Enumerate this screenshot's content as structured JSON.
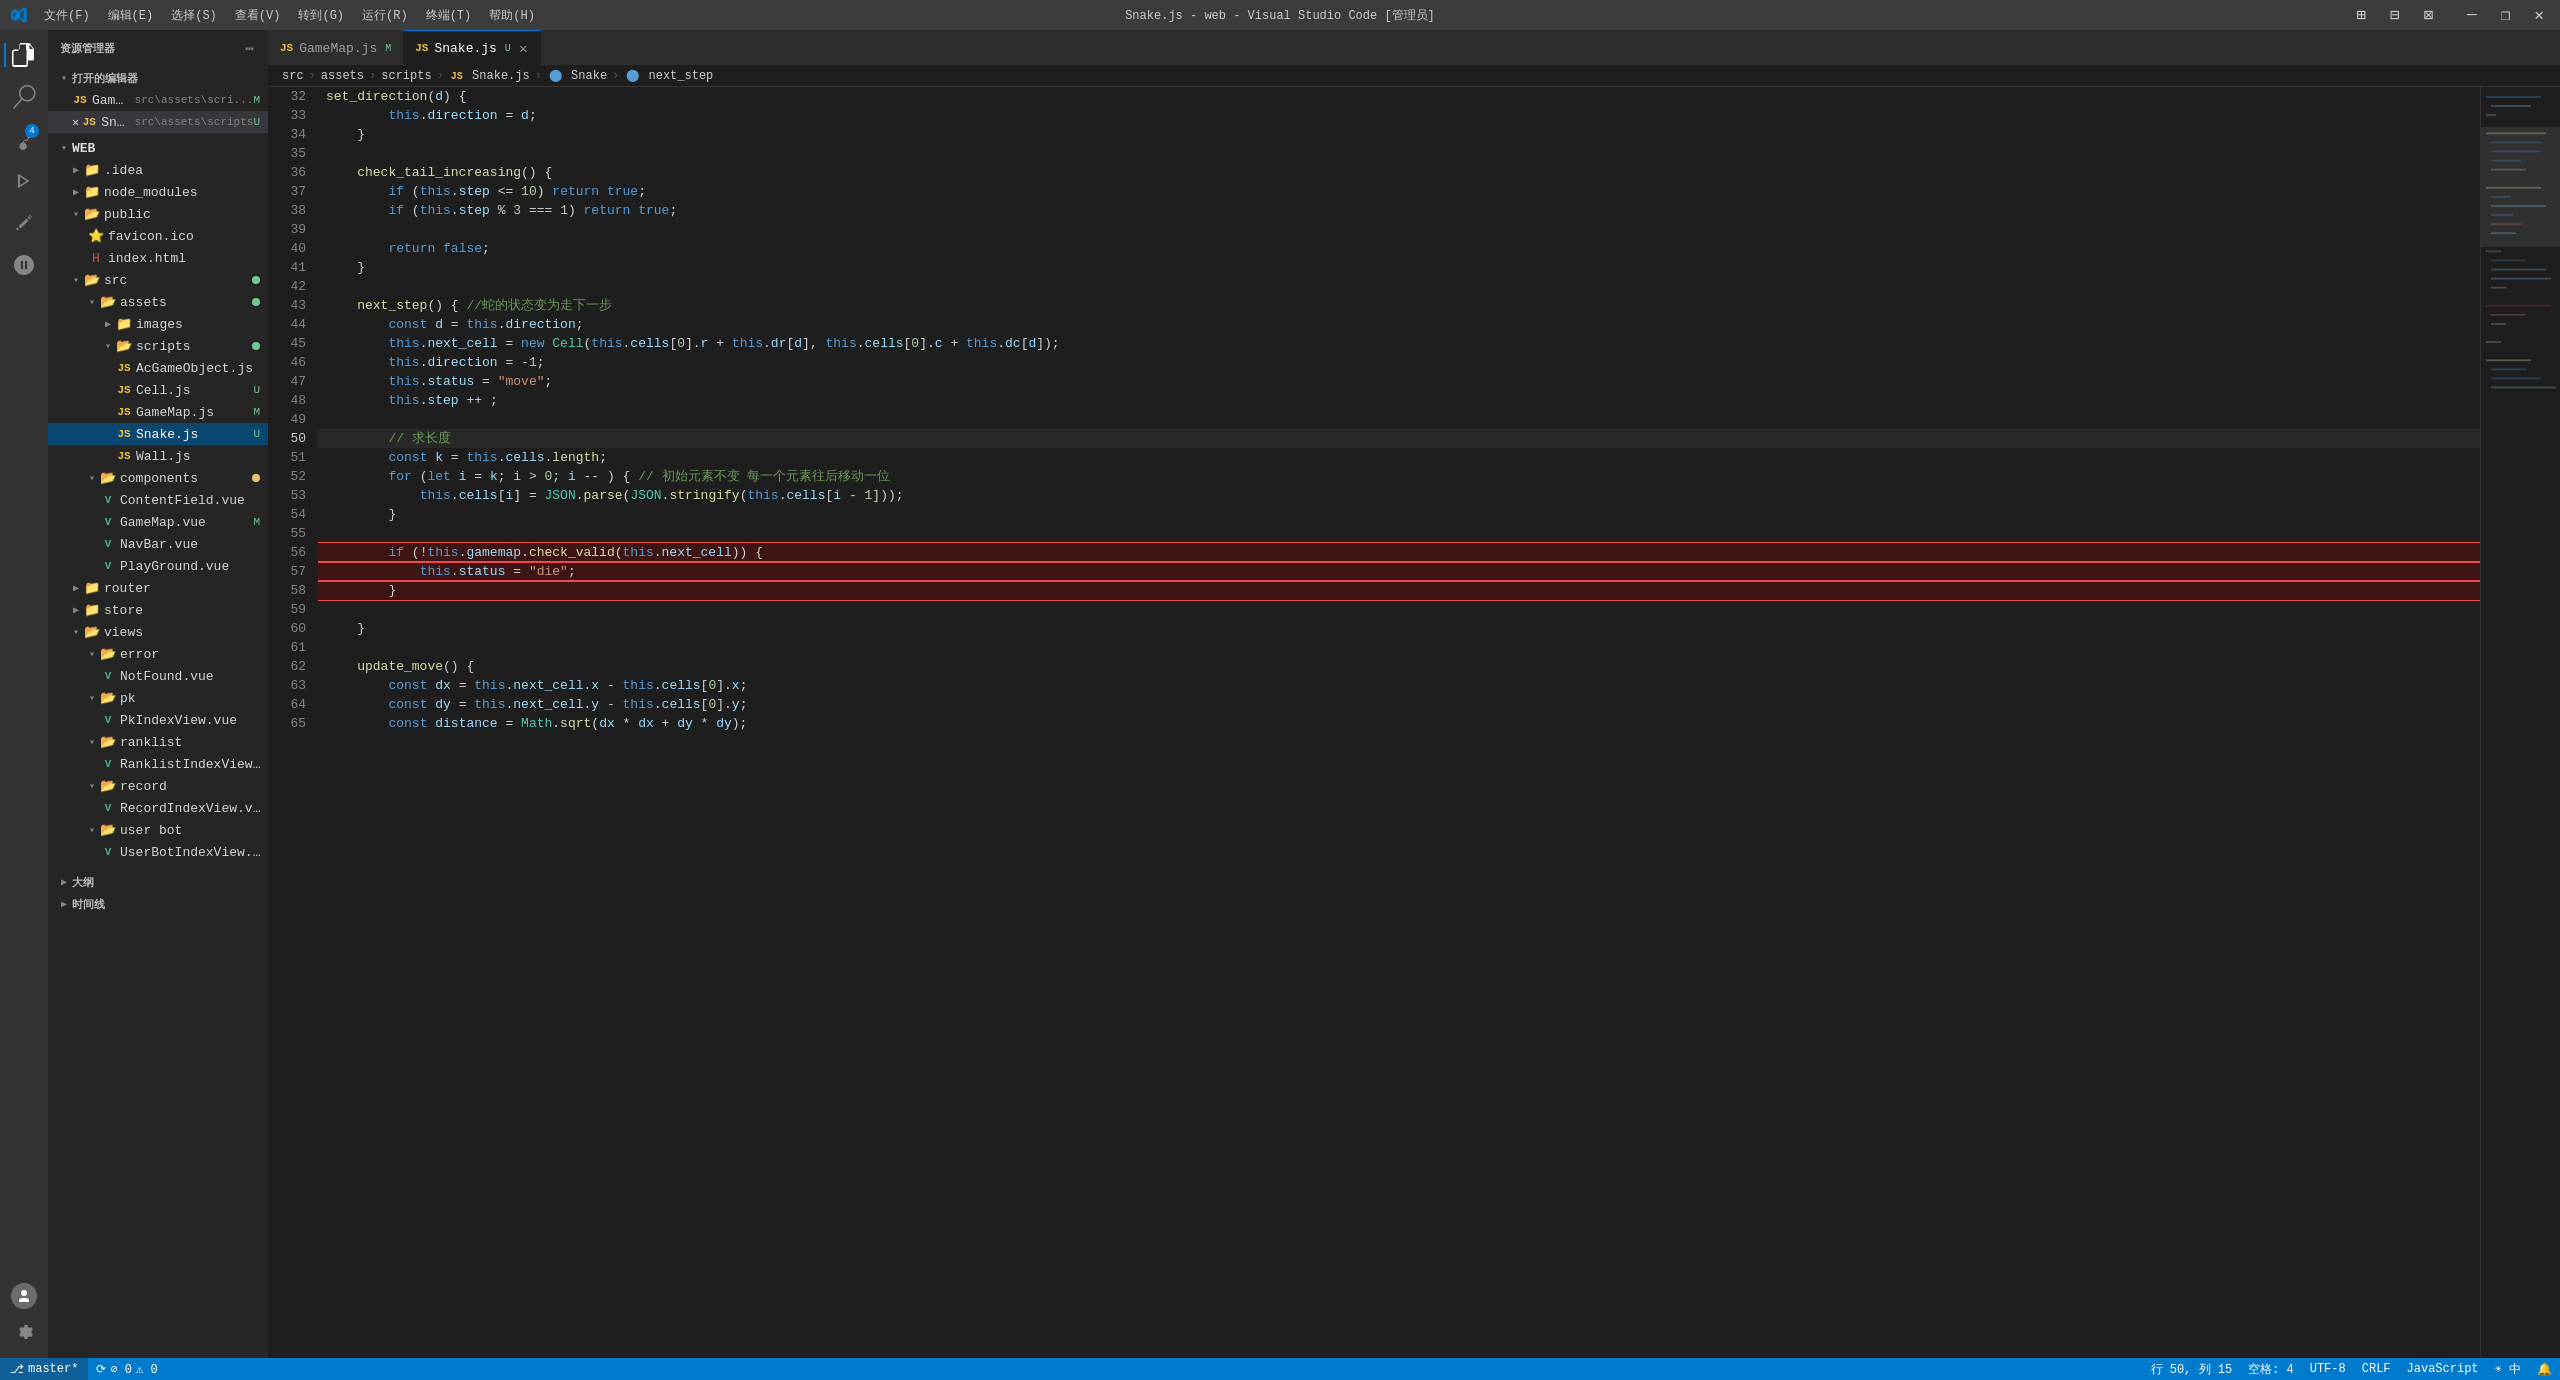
{
  "titlebar": {
    "title": "Snake.js - web - Visual Studio Code [管理员]",
    "menus": [
      "文件(F)",
      "编辑(E)",
      "选择(S)",
      "查看(V)",
      "转到(G)",
      "运行(R)",
      "终端(T)",
      "帮助(H)"
    ],
    "controls": [
      "—",
      "❐",
      "✕"
    ]
  },
  "sidebar": {
    "header": "资源管理器",
    "open_editors_label": "打开的编辑器",
    "open_editors": [
      {
        "name": "GameMap.js",
        "path": "src\\assets\\scri...",
        "badge": "M",
        "icon": "JS"
      },
      {
        "name": "Snake.js",
        "path": "src\\assets\\scripts",
        "badge": "U",
        "icon": "JS",
        "active": true
      }
    ],
    "project_name": "WEB",
    "tree": [
      {
        "name": ".idea",
        "type": "folder",
        "indent": 1,
        "collapsed": true
      },
      {
        "name": "node_modules",
        "type": "folder",
        "indent": 1,
        "collapsed": true
      },
      {
        "name": "public",
        "type": "folder",
        "indent": 1,
        "expanded": true
      },
      {
        "name": "favicon.ico",
        "type": "file",
        "indent": 2,
        "icon": "⭐"
      },
      {
        "name": "index.html",
        "type": "file",
        "indent": 2,
        "icon": "H"
      },
      {
        "name": "src",
        "type": "folder",
        "indent": 1,
        "expanded": true,
        "dot": "green"
      },
      {
        "name": "assets",
        "type": "folder",
        "indent": 2,
        "expanded": true,
        "dot": "green"
      },
      {
        "name": "images",
        "type": "folder",
        "indent": 3,
        "collapsed": true
      },
      {
        "name": "scripts",
        "type": "folder",
        "indent": 3,
        "expanded": true,
        "dot": "green"
      },
      {
        "name": "AcGameObject.js",
        "type": "file",
        "indent": 4,
        "icon": "JS"
      },
      {
        "name": "Cell.js",
        "type": "file",
        "indent": 4,
        "icon": "JS",
        "badge": "U"
      },
      {
        "name": "GameMap.js",
        "type": "file",
        "indent": 4,
        "icon": "JS",
        "badge": "M"
      },
      {
        "name": "Snake.js",
        "type": "file",
        "indent": 4,
        "icon": "JS",
        "badge": "U",
        "active": true
      },
      {
        "name": "Wall.js",
        "type": "file",
        "indent": 4,
        "icon": "JS"
      },
      {
        "name": "components",
        "type": "folder",
        "indent": 2,
        "expanded": true,
        "dot": "yellow"
      },
      {
        "name": "ContentField.vue",
        "type": "file",
        "indent": 3,
        "icon": "V"
      },
      {
        "name": "GameMap.vue",
        "type": "file",
        "indent": 3,
        "icon": "V",
        "badge": "M"
      },
      {
        "name": "NavBar.vue",
        "type": "file",
        "indent": 3,
        "icon": "V"
      },
      {
        "name": "PlayGround.vue",
        "type": "file",
        "indent": 3,
        "icon": "V"
      },
      {
        "name": "router",
        "type": "folder",
        "indent": 1,
        "collapsed": true
      },
      {
        "name": "store",
        "type": "folder",
        "indent": 1,
        "collapsed": true
      },
      {
        "name": "views",
        "type": "folder",
        "indent": 1,
        "expanded": true
      },
      {
        "name": "error",
        "type": "folder",
        "indent": 2,
        "expanded": true
      },
      {
        "name": "NotFound.vue",
        "type": "file",
        "indent": 3,
        "icon": "V"
      },
      {
        "name": "pk",
        "type": "folder",
        "indent": 2,
        "expanded": true
      },
      {
        "name": "PkIndexView.vue",
        "type": "file",
        "indent": 3,
        "icon": "V"
      },
      {
        "name": "ranklist",
        "type": "folder",
        "indent": 2,
        "expanded": true
      },
      {
        "name": "RanklistIndexView.vue",
        "type": "file",
        "indent": 3,
        "icon": "V"
      },
      {
        "name": "record",
        "type": "folder",
        "indent": 2,
        "expanded": true
      },
      {
        "name": "RecordIndexView.vue",
        "type": "file",
        "indent": 3,
        "icon": "V"
      },
      {
        "name": "user bot",
        "type": "folder",
        "indent": 2,
        "expanded": true
      },
      {
        "name": "UserBotIndexView.vue",
        "type": "file",
        "indent": 3,
        "icon": "V"
      }
    ]
  },
  "tabs": [
    {
      "name": "GameMap.js",
      "icon": "JS",
      "badge": "M",
      "active": false,
      "modified": true
    },
    {
      "name": "Snake.js",
      "icon": "JS",
      "badge": "U",
      "active": true,
      "modified": false,
      "dirty": true
    }
  ],
  "breadcrumb": [
    "src",
    ">",
    "assets",
    ">",
    "scripts",
    ">",
    "JS Snake.js",
    ">",
    "🔵 Snake",
    ">",
    "🔵 next_step"
  ],
  "code": {
    "lines": [
      {
        "num": 32,
        "content": "    set_direction(d) {"
      },
      {
        "num": 33,
        "content": "        this.direction = d;"
      },
      {
        "num": 34,
        "content": "    }"
      },
      {
        "num": 35,
        "content": ""
      },
      {
        "num": 36,
        "content": "    check_tail_increasing() {"
      },
      {
        "num": 37,
        "content": "        if (this.step <= 10) return true;"
      },
      {
        "num": 38,
        "content": "        if (this.step % 3 === 1) return true;"
      },
      {
        "num": 39,
        "content": ""
      },
      {
        "num": 40,
        "content": "        return false;"
      },
      {
        "num": 41,
        "content": "    }"
      },
      {
        "num": 42,
        "content": ""
      },
      {
        "num": 43,
        "content": "    next_step() { //蛇的状态变为走下一步"
      },
      {
        "num": 44,
        "content": "        const d = this.direction;"
      },
      {
        "num": 45,
        "content": "        this.next_cell = new Cell(this.cells[0].r + this.dr[d], this.cells[0].c + this.dc[d]);"
      },
      {
        "num": 46,
        "content": "        this.direction = -1;"
      },
      {
        "num": 47,
        "content": "        this.status = \"move\";"
      },
      {
        "num": 48,
        "content": "        this.step ++ ;"
      },
      {
        "num": 49,
        "content": ""
      },
      {
        "num": 50,
        "content": "        // 求长度|"
      },
      {
        "num": 51,
        "content": "        const k = this.cells.length;"
      },
      {
        "num": 52,
        "content": "        for (let i = k; i > 0; i -- ) { // 初始元素不变 每一个元素往后移动一位"
      },
      {
        "num": 53,
        "content": "            this.cells[i] = JSON.parse(JSON.stringify(this.cells[i - 1]));"
      },
      {
        "num": 54,
        "content": "        }"
      },
      {
        "num": 55,
        "content": ""
      },
      {
        "num": 56,
        "content": "        if (!this.gamemap.check_valid(this.next_cell)) {"
      },
      {
        "num": 57,
        "content": "            this.status = \"die\";"
      },
      {
        "num": 58,
        "content": "        }"
      },
      {
        "num": 59,
        "content": ""
      },
      {
        "num": 60,
        "content": "    }"
      },
      {
        "num": 61,
        "content": ""
      },
      {
        "num": 62,
        "content": "    update_move() {"
      },
      {
        "num": 63,
        "content": "        const dx = this.next_cell.x - this.cells[0].x;"
      },
      {
        "num": 64,
        "content": "        const dy = this.next_cell.y - this.cells[0].y;"
      },
      {
        "num": 65,
        "content": "        const distance = Math.sqrt(dx * dx + dy * dy);"
      }
    ]
  },
  "statusbar": {
    "branch": "master*",
    "sync": "⟳",
    "errors": "0",
    "warnings": "0",
    "position": "行 50, 列 15",
    "spaces": "空格: 4",
    "encoding": "UTF-8",
    "eol": "CRLF",
    "language": "JavaScript",
    "feedback": "☀ 中",
    "notifications": "🔔"
  },
  "sections": {
    "large": "大纲",
    "timeline": "时间线"
  }
}
